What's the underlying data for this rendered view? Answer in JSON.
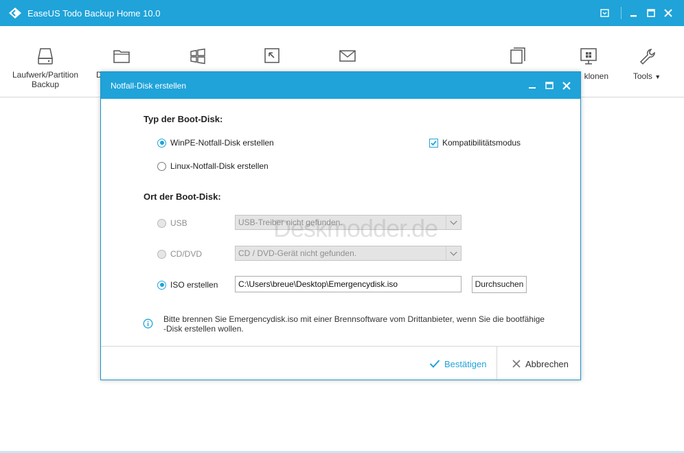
{
  "app": {
    "title": "EaseUS Todo Backup Home 10.0",
    "accent_color": "#1fa3d9"
  },
  "titlebar_controls": [
    {
      "icon": "message-icon"
    },
    {
      "icon": "minimize-icon"
    },
    {
      "icon": "maximize-icon"
    },
    {
      "icon": "close-icon"
    }
  ],
  "toolbar": {
    "disk_backup": {
      "label_line1": "Laufwerk/Partition",
      "label_line2": "Backup",
      "icon": "hard-drive-icon"
    },
    "file_backup": {
      "label": "D",
      "icon": "folder-icon"
    },
    "system_backup": {
      "icon": "windows-grid-icon"
    },
    "smart_backup": {
      "icon": "arrow-square-icon"
    },
    "mail_backup": {
      "icon": "mail-icon"
    },
    "clone": {
      "icon": "copy-icon"
    },
    "system_clone": {
      "label": "klonen",
      "icon": "windows-monitor-icon"
    },
    "tools": {
      "label": "Tools",
      "icon": "wrench-icon"
    }
  },
  "dialog": {
    "title": "Notfall-Disk erstellen",
    "type_section_title": "Typ der Boot-Disk:",
    "winpe_label": "WinPE-Notfall-Disk erstellen",
    "linux_label": "Linux-Notfall-Disk erstellen",
    "compat_label": "Kompatibilitätsmodus",
    "compat_checked": true,
    "location_section_title": "Ort der Boot-Disk:",
    "usb_label": "USB",
    "usb_value": "USB-Treiber nicht gefunden.",
    "cd_label": "CD/DVD",
    "cd_value": "CD / DVD-Gerät nicht gefunden.",
    "iso_label": "ISO erstellen",
    "iso_path": "C:\\Users\\breue\\Desktop\\Emergencydisk.iso",
    "browse_label": "Durchsuchen",
    "info_text": "Bitte brennen Sie Emergencydisk.iso mit einer  Brennsoftware vom Drittanbieter, wenn Sie die bootfähige -Disk erstellen wollen.",
    "confirm_label": "Bestätigen",
    "cancel_label": "Abbrechen"
  },
  "watermark": "Deskmodder.de"
}
